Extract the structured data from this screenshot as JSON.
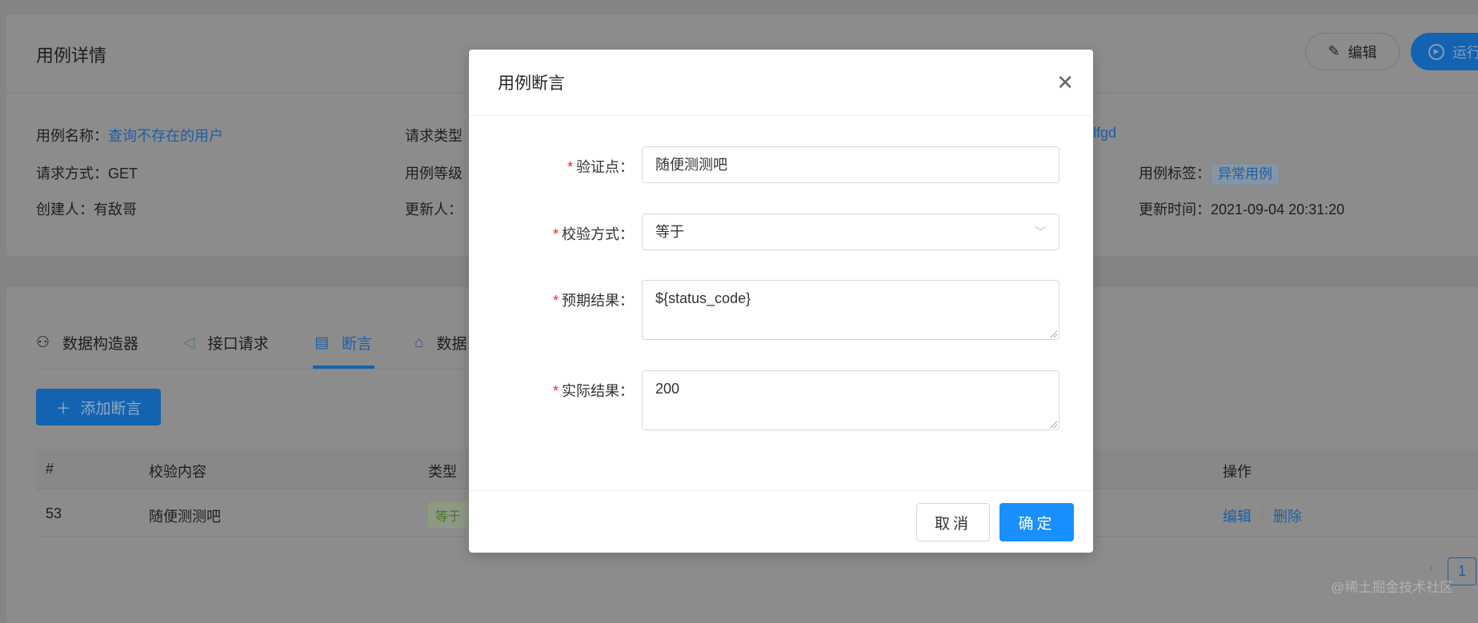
{
  "detail": {
    "title": "用例详情",
    "edit_button": "编辑",
    "run_button": "运行",
    "fields": {
      "name_label": "用例名称：",
      "name_value": "查询不存在的用户",
      "req_type_label": "请求类型",
      "method_label": "请求方式：",
      "method_value": "GET",
      "level_label": "用例等级",
      "creator_label": "创建人：",
      "creator_value": "有敌哥",
      "updater_label": "更新人：",
      "partial_value": "lfgd",
      "tag_label": "用例标签：",
      "tag_value": "异常用例",
      "updated_label": "更新时间：",
      "updated_value": "2021-09-04 20:31:20"
    }
  },
  "tabs": [
    {
      "label": "数据构造器",
      "icon": "cluster-icon"
    },
    {
      "label": "接口请求",
      "icon": "send-icon"
    },
    {
      "label": "断言",
      "icon": "file-icon",
      "active": true
    },
    {
      "label": "数据",
      "icon": "bank-icon"
    }
  ],
  "add_assert_button": "添加断言",
  "table": {
    "headers": [
      "#",
      "校验内容",
      "类型",
      "操作"
    ],
    "rows": [
      {
        "id": "53",
        "content": "随便测测吧",
        "type": "等于",
        "actions": [
          "编辑",
          "删除"
        ]
      }
    ]
  },
  "pagination": {
    "current": "1"
  },
  "watermark": "@稀土掘金技术社区",
  "modal": {
    "title": "用例断言",
    "fields": [
      {
        "label": "验证点：",
        "value": "随便测测吧"
      },
      {
        "label": "校验方式：",
        "value": "等于"
      },
      {
        "label": "预期结果：",
        "value": "${status_code}"
      },
      {
        "label": "实际结果：",
        "value": "200"
      }
    ],
    "cancel": "取消",
    "ok": "确定"
  },
  "colors": {
    "primary": "#1890ff",
    "required": "#f5222d"
  }
}
